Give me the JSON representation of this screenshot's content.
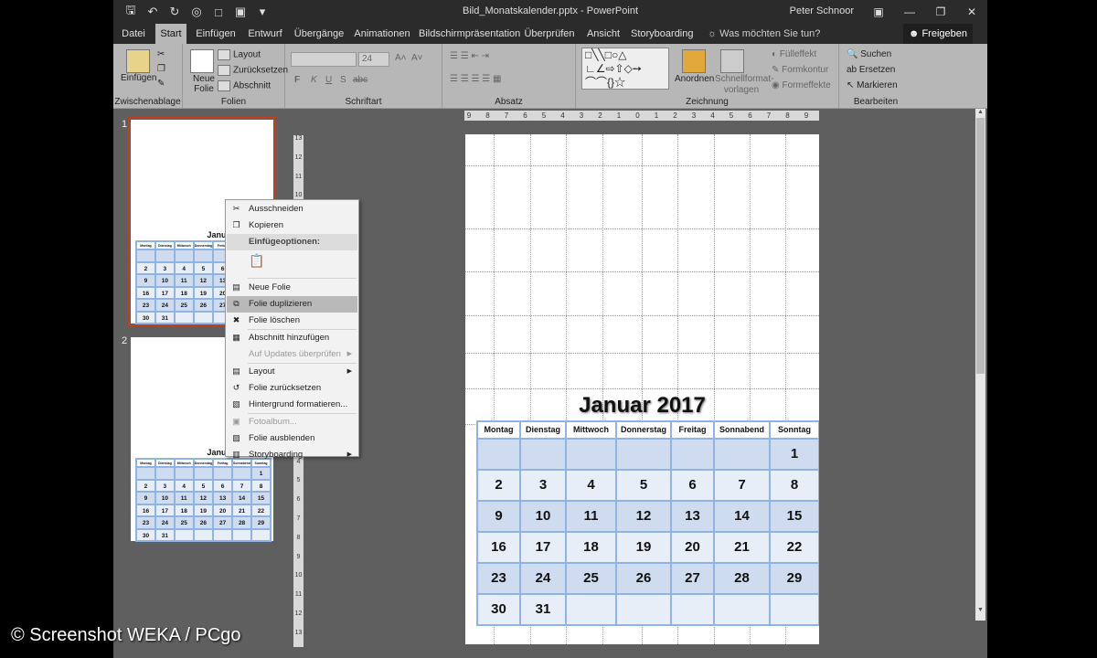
{
  "titlebar": {
    "filename": "Bild_Monatskalender.pptx - PowerPoint",
    "user": "Peter Schnoor"
  },
  "tabs": [
    "Datei",
    "Start",
    "Einfügen",
    "Entwurf",
    "Übergänge",
    "Animationen",
    "Bildschirmpräsentation",
    "Überprüfen",
    "Ansicht",
    "Storyboarding"
  ],
  "tell_me": "Was möchten Sie tun?",
  "share": "Freigeben",
  "ribbon": {
    "clipboard": {
      "label": "Zwischenablage",
      "paste": "Einfügen"
    },
    "slides": {
      "label": "Folien",
      "new_slide": "Neue Folie",
      "layout": "Layout",
      "reset": "Zurücksetzen",
      "section": "Abschnitt"
    },
    "font": {
      "label": "Schriftart",
      "size": "24",
      "bold": "F",
      "italic": "K",
      "underline": "U",
      "strike": "S",
      "abc": "abc"
    },
    "paragraph": {
      "label": "Absatz"
    },
    "drawing": {
      "label": "Zeichnung",
      "arrange": "Anordnen",
      "quick_styles": "Schnellformat-vorlagen",
      "fill": "Fülleffekt",
      "outline": "Formkontur",
      "effects": "Formeffekte"
    },
    "editing": {
      "label": "Bearbeiten",
      "find": "Suchen",
      "replace": "Ersetzen",
      "select": "Markieren"
    }
  },
  "slides": [
    {
      "number": "1"
    },
    {
      "number": "2"
    }
  ],
  "calendar": {
    "title": "Januar 2017",
    "days": [
      "Montag",
      "Dienstag",
      "Mittwoch",
      "Donnerstag",
      "Freitag",
      "Sonnabend",
      "Sonntag"
    ],
    "weeks": [
      [
        "",
        "",
        "",
        "",
        "",
        "",
        "1"
      ],
      [
        "2",
        "3",
        "4",
        "5",
        "6",
        "7",
        "8"
      ],
      [
        "9",
        "10",
        "11",
        "12",
        "13",
        "14",
        "15"
      ],
      [
        "16",
        "17",
        "18",
        "19",
        "20",
        "21",
        "22"
      ],
      [
        "23",
        "24",
        "25",
        "26",
        "27",
        "28",
        "29"
      ],
      [
        "30",
        "31",
        "",
        "",
        "",
        "",
        ""
      ]
    ]
  },
  "context_menu": [
    {
      "label": "Ausschneiden",
      "icon": "scissors-icon",
      "type": "item"
    },
    {
      "label": "Kopieren",
      "icon": "copy-icon",
      "type": "item"
    },
    {
      "label": "Einfügeoptionen:",
      "type": "section"
    },
    {
      "label": "",
      "icon": "paste-keep-text-icon",
      "type": "paste"
    },
    {
      "label": "Neue Folie",
      "icon": "new-slide-icon",
      "type": "item"
    },
    {
      "label": "Folie duplizieren",
      "icon": "duplicate-slide-icon",
      "type": "item",
      "highlighted": true
    },
    {
      "label": "Folie löschen",
      "icon": "delete-slide-icon",
      "type": "item"
    },
    {
      "label": "Abschnitt hinzufügen",
      "icon": "add-section-icon",
      "type": "item"
    },
    {
      "label": "Auf Updates überprüfen",
      "icon": "",
      "type": "item",
      "disabled": true,
      "submenu": true
    },
    {
      "label": "Layout",
      "icon": "layout-icon",
      "type": "item",
      "submenu": true
    },
    {
      "label": "Folie zurücksetzen",
      "icon": "reset-slide-icon",
      "type": "item"
    },
    {
      "label": "Hintergrund formatieren...",
      "icon": "format-background-icon",
      "type": "item"
    },
    {
      "label": "Fotoalbum...",
      "icon": "photo-album-icon",
      "type": "item",
      "disabled": true
    },
    {
      "label": "Folie ausblenden",
      "icon": "hide-slide-icon",
      "type": "item"
    },
    {
      "label": "Storyboarding",
      "icon": "storyboarding-icon",
      "type": "item",
      "submenu": true
    }
  ],
  "ruler": {
    "h": [
      "9",
      "8",
      "7",
      "6",
      "5",
      "4",
      "3",
      "2",
      "1",
      "0",
      "1",
      "2",
      "3",
      "4",
      "5",
      "6",
      "7",
      "8",
      "9"
    ],
    "v": [
      "13",
      "12",
      "11",
      "10",
      "9",
      "8",
      "7",
      "6",
      "5",
      "4",
      "3",
      "2",
      "1",
      "0",
      "1",
      "2",
      "3",
      "4",
      "5",
      "6",
      "7",
      "8",
      "9",
      "10",
      "11",
      "12",
      "13"
    ]
  },
  "watermark": "© Screenshot WEKA / PCgo",
  "colors": {
    "accent": "#c43e1c",
    "grid": "#8fb4e3",
    "band1": "#cfdcef",
    "band2": "#e8eef8"
  }
}
